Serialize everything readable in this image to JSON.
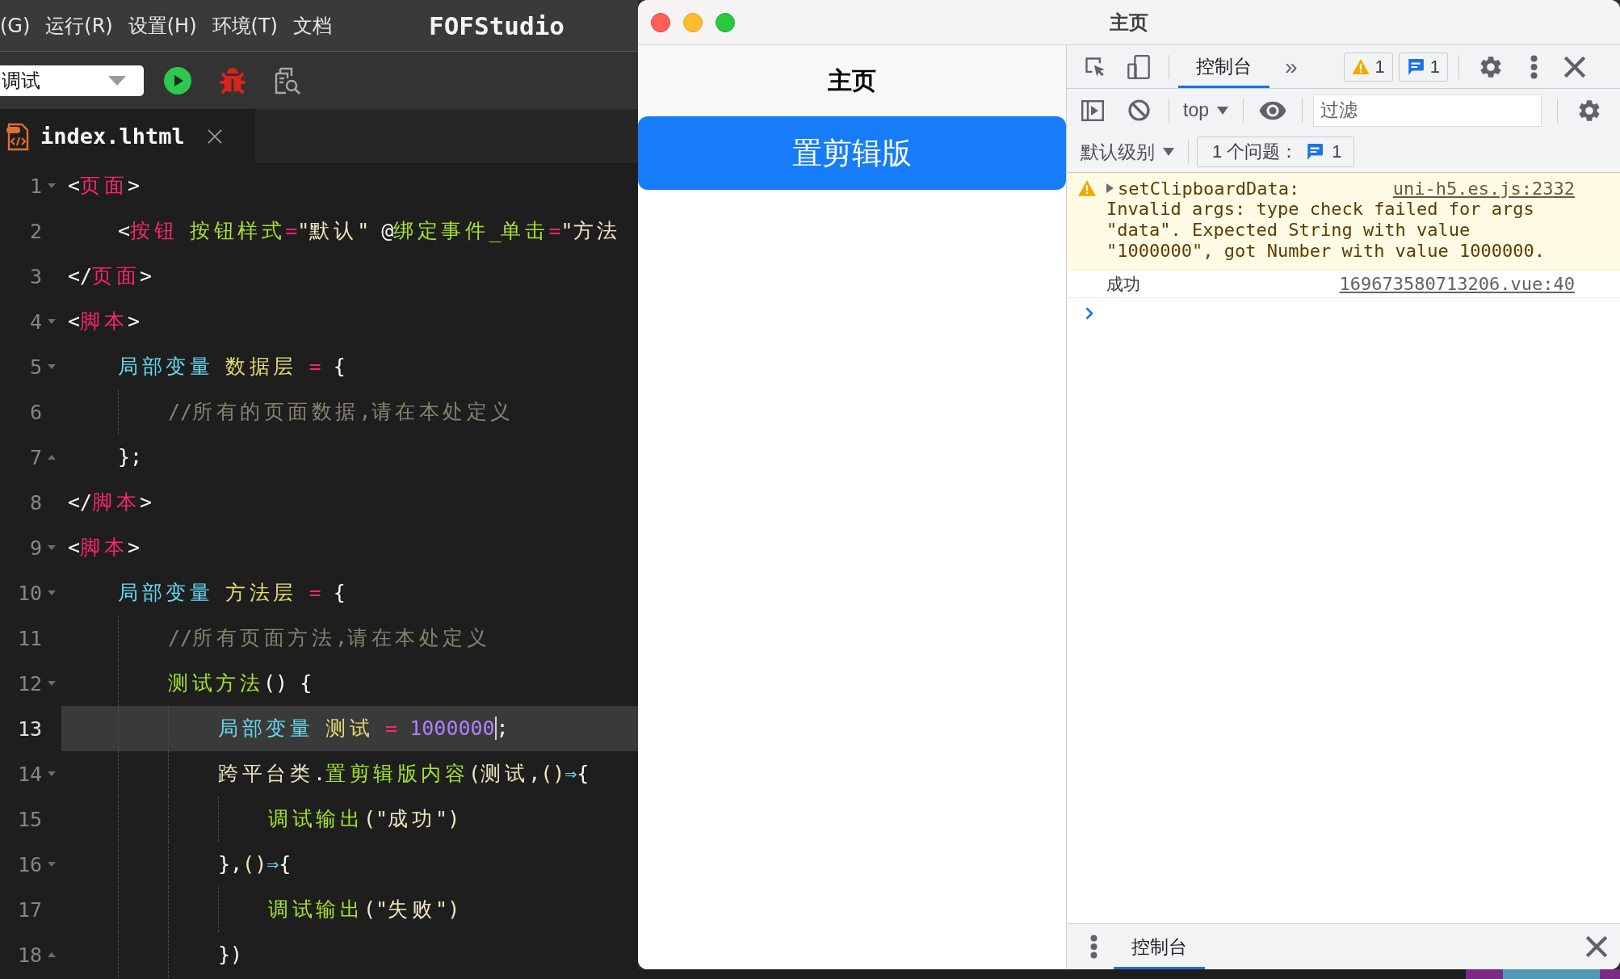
{
  "editor": {
    "menu": [
      "(G)",
      "运行(R)",
      "设置(H)",
      "环境(T)",
      "文档"
    ],
    "app_title": "FOFStudio",
    "toolbar": {
      "mode": "调试"
    },
    "tabs": [
      {
        "label": "index.lhtml",
        "selected": true
      }
    ],
    "lines": [
      {
        "number": "1",
        "fold_start": true,
        "fold_end": false,
        "current": false,
        "tokens": [
          {
            "text": "<",
            "kind": "punct"
          },
          {
            "text": "页面",
            "kind": "tag"
          },
          {
            "text": ">",
            "kind": "punct"
          }
        ],
        "children": [
          {
            "number": "2",
            "fold_start": false,
            "fold_end": false,
            "current": false,
            "tokens": [
              {
                "text": "<",
                "kind": "punct"
              },
              {
                "text": "按钮",
                "kind": "tag"
              },
              {
                "text": " 按钮样式",
                "kind": "attr"
              },
              {
                "text": "=",
                "kind": "operator"
              },
              {
                "text": "\"默认\"",
                "kind": "string"
              },
              {
                "text": " @",
                "kind": "punct"
              },
              {
                "text": "绑定事件_单击",
                "kind": "attr"
              },
              {
                "text": "=",
                "kind": "operator"
              },
              {
                "text": "\"方法",
                "kind": "string"
              }
            ]
          }
        ]
      },
      {
        "number": "3",
        "fold_start": false,
        "fold_end": false,
        "current": false,
        "tokens": [
          {
            "text": "</",
            "kind": "punct"
          },
          {
            "text": "页面",
            "kind": "tag"
          },
          {
            "text": ">",
            "kind": "punct"
          }
        ]
      },
      {
        "number": "4",
        "fold_start": true,
        "fold_end": false,
        "current": false,
        "tokens": [
          {
            "text": "<",
            "kind": "punct"
          },
          {
            "text": "脚本",
            "kind": "tag"
          },
          {
            "text": ">",
            "kind": "punct"
          }
        ],
        "children": [
          {
            "number": "5",
            "fold_start": true,
            "fold_end": false,
            "current": false,
            "tokens": [
              {
                "text": "局部变量",
                "kind": "keyword"
              },
              {
                "text": " 数据层",
                "kind": "ident"
              },
              {
                "text": " =",
                "kind": "operator"
              },
              {
                "text": " {",
                "kind": "punct"
              }
            ],
            "children": [
              {
                "number": "6",
                "fold_start": false,
                "fold_end": false,
                "current": false,
                "tokens": [
                  {
                    "text": "//所有的页面数据,请在本处定义",
                    "kind": "comment"
                  }
                ]
              }
            ]
          },
          {
            "number": "7",
            "fold_start": false,
            "fold_end": true,
            "current": false,
            "tokens": [
              {
                "text": "};",
                "kind": "punct"
              }
            ]
          }
        ]
      },
      {
        "number": "8",
        "fold_start": false,
        "fold_end": false,
        "current": false,
        "tokens": [
          {
            "text": "</",
            "kind": "punct"
          },
          {
            "text": "脚本",
            "kind": "tag"
          },
          {
            "text": ">",
            "kind": "punct"
          }
        ]
      },
      {
        "number": "9",
        "fold_start": true,
        "fold_end": false,
        "current": false,
        "tokens": [
          {
            "text": "<",
            "kind": "punct"
          },
          {
            "text": "脚本",
            "kind": "tag"
          },
          {
            "text": ">",
            "kind": "punct"
          }
        ],
        "children": [
          {
            "number": "10",
            "fold_start": true,
            "fold_end": false,
            "current": false,
            "tokens": [
              {
                "text": "局部变量",
                "kind": "keyword"
              },
              {
                "text": " 方法层",
                "kind": "ident"
              },
              {
                "text": " =",
                "kind": "operator"
              },
              {
                "text": " {",
                "kind": "punct"
              }
            ],
            "children": [
              {
                "number": "11",
                "fold_start": false,
                "fold_end": false,
                "current": false,
                "tokens": [
                  {
                    "text": "//所有页面方法,请在本处定义",
                    "kind": "comment"
                  }
                ]
              },
              {
                "number": "12",
                "fold_start": true,
                "fold_end": false,
                "current": false,
                "tokens": [
                  {
                    "text": "测试方法",
                    "kind": "function"
                  },
                  {
                    "text": "() {",
                    "kind": "punct"
                  }
                ],
                "children": [
                  {
                    "number": "13",
                    "fold_start": false,
                    "fold_end": false,
                    "current": true,
                    "tokens": [
                      {
                        "text": "局部变量",
                        "kind": "keyword"
                      },
                      {
                        "text": " 测试",
                        "kind": "ident"
                      },
                      {
                        "text": " =",
                        "kind": "operator"
                      },
                      {
                        "text": " 1000000",
                        "kind": "number",
                        "caret": true
                      },
                      {
                        "text": ";",
                        "kind": "punct"
                      }
                    ]
                  },
                  {
                    "number": "14",
                    "fold_start": true,
                    "fold_end": false,
                    "current": false,
                    "tokens": [
                      {
                        "text": "跨平台类",
                        "kind": "plain"
                      },
                      {
                        "text": ".",
                        "kind": "punct"
                      },
                      {
                        "text": "置剪辑版内容",
                        "kind": "function"
                      },
                      {
                        "text": "(测试,()",
                        "kind": "plain"
                      },
                      {
                        "text": "⇒",
                        "kind": "arrow"
                      },
                      {
                        "text": "{",
                        "kind": "punct"
                      }
                    ],
                    "children": [
                      {
                        "number": "15",
                        "fold_start": false,
                        "fold_end": false,
                        "current": false,
                        "tokens": [
                          {
                            "text": "调试输出",
                            "kind": "function"
                          },
                          {
                            "text": "(\"成功\")",
                            "kind": "plain"
                          }
                        ]
                      }
                    ]
                  },
                  {
                    "number": "16",
                    "fold_start": true,
                    "fold_end": false,
                    "current": false,
                    "tokens": [
                      {
                        "text": "},",
                        "kind": "punct"
                      },
                      {
                        "text": "()",
                        "kind": "plain"
                      },
                      {
                        "text": "⇒",
                        "kind": "arrow"
                      },
                      {
                        "text": "{",
                        "kind": "punct"
                      }
                    ],
                    "children": [
                      {
                        "number": "17",
                        "fold_start": false,
                        "fold_end": false,
                        "current": false,
                        "tokens": [
                          {
                            "text": "调试输出",
                            "kind": "function"
                          },
                          {
                            "text": "(\"失败\")",
                            "kind": "plain"
                          }
                        ]
                      }
                    ]
                  },
                  {
                    "number": "18",
                    "fold_start": false,
                    "fold_end": true,
                    "current": false,
                    "tokens": [
                      {
                        "text": "})",
                        "kind": "punct"
                      }
                    ]
                  }
                ]
              }
            ]
          }
        ]
      }
    ]
  },
  "simulator": {
    "title": "主页",
    "page": {
      "nav_title": "主页",
      "button": "置剪辑版"
    },
    "devtools": {
      "tabs": [
        {
          "label": "控制台",
          "selected": true
        }
      ],
      "more": "»",
      "counters": [
        {
          "kind": "warning",
          "count": "1"
        },
        {
          "kind": "info",
          "count": "1"
        }
      ],
      "context": "top",
      "filter": {
        "placeholder": "过滤"
      },
      "level": "默认级别",
      "issues": {
        "label": "1 个问题：",
        "count": "1"
      },
      "messages": [
        {
          "kind": "warning",
          "title": "setClipboardData:",
          "text": "Invalid args: type check failed for args \"data\". Expected String with value \"1000000\", got Number with value 1000000.",
          "source": "uni-h5.es.js:2332"
        },
        {
          "kind": "log",
          "text": "成功",
          "source": "169673580713206.vue:40"
        }
      ],
      "drawer": {
        "tabs": [
          {
            "label": "控制台",
            "selected": true
          }
        ]
      }
    }
  }
}
